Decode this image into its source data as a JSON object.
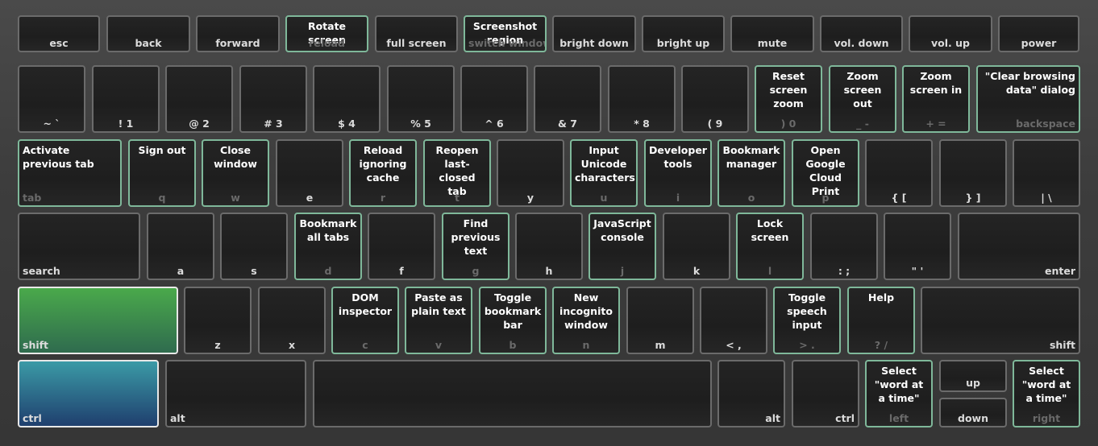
{
  "rows": [
    [
      {
        "label": "esc"
      },
      {
        "label": "back"
      },
      {
        "label": "forward"
      },
      {
        "label": "reload",
        "shortcut": "Rotate screen"
      },
      {
        "label": "full screen"
      },
      {
        "label": "switch window",
        "shortcut": "Screenshot region"
      },
      {
        "label": "bright down"
      },
      {
        "label": "bright up"
      },
      {
        "label": "mute"
      },
      {
        "label": "vol. down"
      },
      {
        "label": "vol. up"
      },
      {
        "label": "power"
      }
    ],
    [
      {
        "label": "~ `"
      },
      {
        "label": "! 1"
      },
      {
        "label": "@ 2"
      },
      {
        "label": "# 3"
      },
      {
        "label": "$ 4"
      },
      {
        "label": "% 5"
      },
      {
        "label": "^ 6"
      },
      {
        "label": "& 7"
      },
      {
        "label": "* 8"
      },
      {
        "label": "( 9"
      },
      {
        "label": ") 0",
        "shortcut": "Reset screen zoom"
      },
      {
        "label": "_ -",
        "shortcut": "Zoom screen out"
      },
      {
        "label": "+ =",
        "shortcut": "Zoom screen in"
      },
      {
        "label": "backspace",
        "shortcut": "\"Clear browsing data\" dialog"
      }
    ],
    [
      {
        "label": "tab",
        "shortcut": "Activate previous tab"
      },
      {
        "label": "q",
        "shortcut": "Sign out"
      },
      {
        "label": "w",
        "shortcut": "Close window"
      },
      {
        "label": "e"
      },
      {
        "label": "r",
        "shortcut": "Reload ignoring cache"
      },
      {
        "label": "t",
        "shortcut": "Reopen last-closed tab"
      },
      {
        "label": "y"
      },
      {
        "label": "u",
        "shortcut": "Input Unicode characters"
      },
      {
        "label": "i",
        "shortcut": "Developer tools"
      },
      {
        "label": "o",
        "shortcut": "Bookmark manager"
      },
      {
        "label": "p",
        "shortcut": "Open Google Cloud Print"
      },
      {
        "label": "{ ["
      },
      {
        "label": "} ]"
      },
      {
        "label": "| \\"
      }
    ],
    [
      {
        "label": "search"
      },
      {
        "label": "a"
      },
      {
        "label": "s"
      },
      {
        "label": "d",
        "shortcut": "Bookmark all tabs"
      },
      {
        "label": "f"
      },
      {
        "label": "g",
        "shortcut": "Find previous text"
      },
      {
        "label": "h"
      },
      {
        "label": "j",
        "shortcut": "JavaScript console"
      },
      {
        "label": "k"
      },
      {
        "label": "l",
        "shortcut": "Lock screen"
      },
      {
        "label": ": ;"
      },
      {
        "label": "\" '"
      },
      {
        "label": "enter"
      }
    ],
    [
      {
        "label": "shift",
        "active": true
      },
      {
        "label": "z"
      },
      {
        "label": "x"
      },
      {
        "label": "c",
        "shortcut": "DOM inspector"
      },
      {
        "label": "v",
        "shortcut": "Paste as plain text"
      },
      {
        "label": "b",
        "shortcut": "Toggle bookmark bar"
      },
      {
        "label": "n",
        "shortcut": "New incognito window"
      },
      {
        "label": "m"
      },
      {
        "label": "< ,"
      },
      {
        "label": "> .",
        "shortcut": "Toggle speech input"
      },
      {
        "label": "? /",
        "shortcut": "Help"
      },
      {
        "label": "shift"
      }
    ],
    [
      {
        "label": "ctrl",
        "active": true
      },
      {
        "label": "alt"
      },
      {
        "label": ""
      },
      {
        "label": "alt"
      },
      {
        "label": "ctrl"
      },
      {
        "label": "left",
        "shortcut": "Select \"word at a time\""
      },
      {
        "label": "up"
      },
      {
        "label": "down"
      },
      {
        "label": "right",
        "shortcut": "Select \"word at a time\""
      }
    ]
  ],
  "colors": {
    "shortcut_border": "#7fb89a",
    "shift_gradient": [
      "#4aa94b",
      "#2f6b4e"
    ],
    "ctrl_gradient": [
      "#3b9aa6",
      "#1f3f6e"
    ]
  }
}
